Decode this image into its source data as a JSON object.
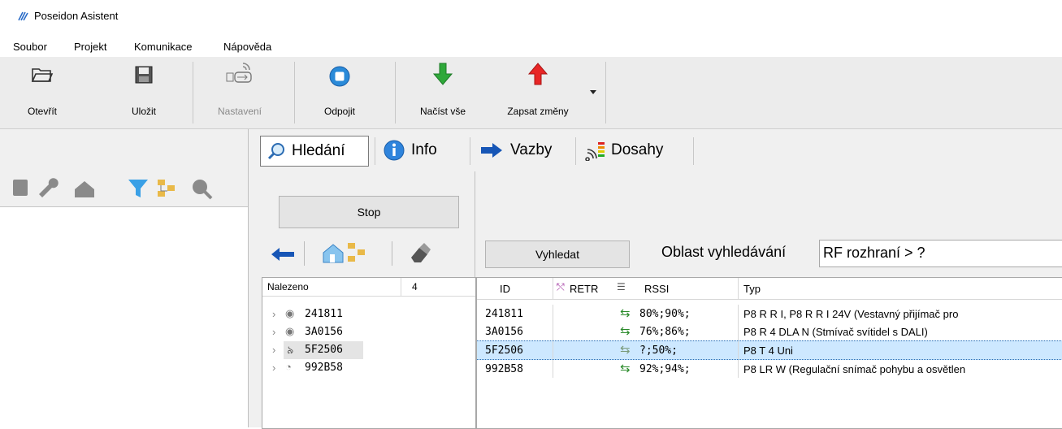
{
  "window": {
    "title": "Poseidon Asistent"
  },
  "menu": [
    "Soubor",
    "Projekt",
    "Komunikace",
    "Nápověda"
  ],
  "toolbar": {
    "open": "Otevřít",
    "save": "Uložit",
    "settings": "Nastavení",
    "disconnect": "Odpojit",
    "read_all": "Načíst vše",
    "write_changes": "Zapsat změny"
  },
  "tabs": [
    "Hledání",
    "Info",
    "Vazby",
    "Dosahy"
  ],
  "search": {
    "stop_label": "Stop",
    "search_label": "Vyhledat",
    "area_label": "Oblast vyhledávání",
    "area_value": "RF rozhraní > ?"
  },
  "found": {
    "header": "Nalezeno",
    "count": "4",
    "items": [
      "241811",
      "3A0156",
      "5F2506",
      "992B58"
    ]
  },
  "results": {
    "columns": [
      "ID",
      "RETR",
      "RSSI",
      "Typ"
    ],
    "rows": [
      {
        "id": "241811",
        "rssi": "80%;90%;",
        "type": "P8 R R I, P8 R R I 24V  (Vestavný přijímač pro"
      },
      {
        "id": "3A0156",
        "rssi": "76%;86%;",
        "type": "P8 R 4 DLA N  (Stmívač svítidel s DALI)"
      },
      {
        "id": "5F2506",
        "rssi": "?;50%;",
        "type": "P8 T 4 Uni"
      },
      {
        "id": "992B58",
        "rssi": "92%;94%;",
        "type": "P8 LR W  (Regulační snímač pohybu a osvětlen"
      }
    ],
    "selected_index": 2
  },
  "colors": {
    "accent": "#1e6fd0",
    "selection": "#cde8ff"
  }
}
